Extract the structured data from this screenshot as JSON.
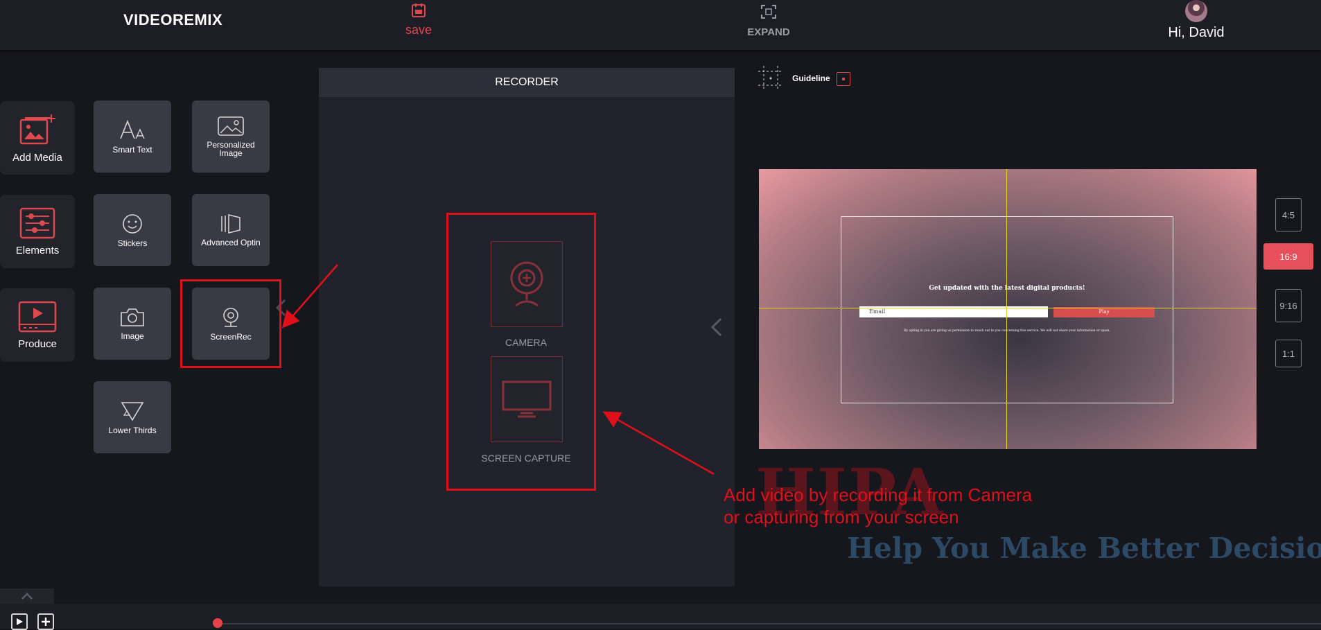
{
  "header": {
    "logo_main": "VIDEOREM",
    "logo_accent": "IX",
    "save_label": "save",
    "expand_label": "EXPAND",
    "greeting": "Hi, David"
  },
  "left_menu": {
    "add_media": "Add Media",
    "elements": "Elements",
    "produce": "Produce"
  },
  "tools": {
    "smart_text": "Smart Text",
    "personalized_image": "Personalized Image",
    "stickers": "Stickers",
    "advanced_optin": "Advanced Optin",
    "image": "Image",
    "screenrec": "ScreenRec",
    "lower_thirds": "Lower Thirds"
  },
  "recorder": {
    "title": "RECORDER",
    "camera": "CAMERA",
    "screen_capture": "SCREEN CAPTURE"
  },
  "guideline": {
    "label": "Guideline"
  },
  "preview": {
    "optin_title": "Get updated with the latest digital products!",
    "email_placeholder": "Email",
    "play_label": "Play",
    "note": "By opting in you are giving us permission to reach out to you concerning this service. We will not share your information or spam."
  },
  "ratios": [
    "4:5",
    "16:9",
    "9:16",
    "1:1"
  ],
  "active_ratio": "16:9",
  "annotation": {
    "line1": "Add video by recording it from Camera",
    "line2": "or capturing from your screen"
  },
  "watermark": {
    "big": "HIPA",
    "tagline": "Help You Make Better Decisions"
  },
  "colors": {
    "accent": "#e6505a",
    "annotation_red": "#e0101a",
    "background": "#16161d",
    "guide_yellow": "#e8d22a"
  }
}
